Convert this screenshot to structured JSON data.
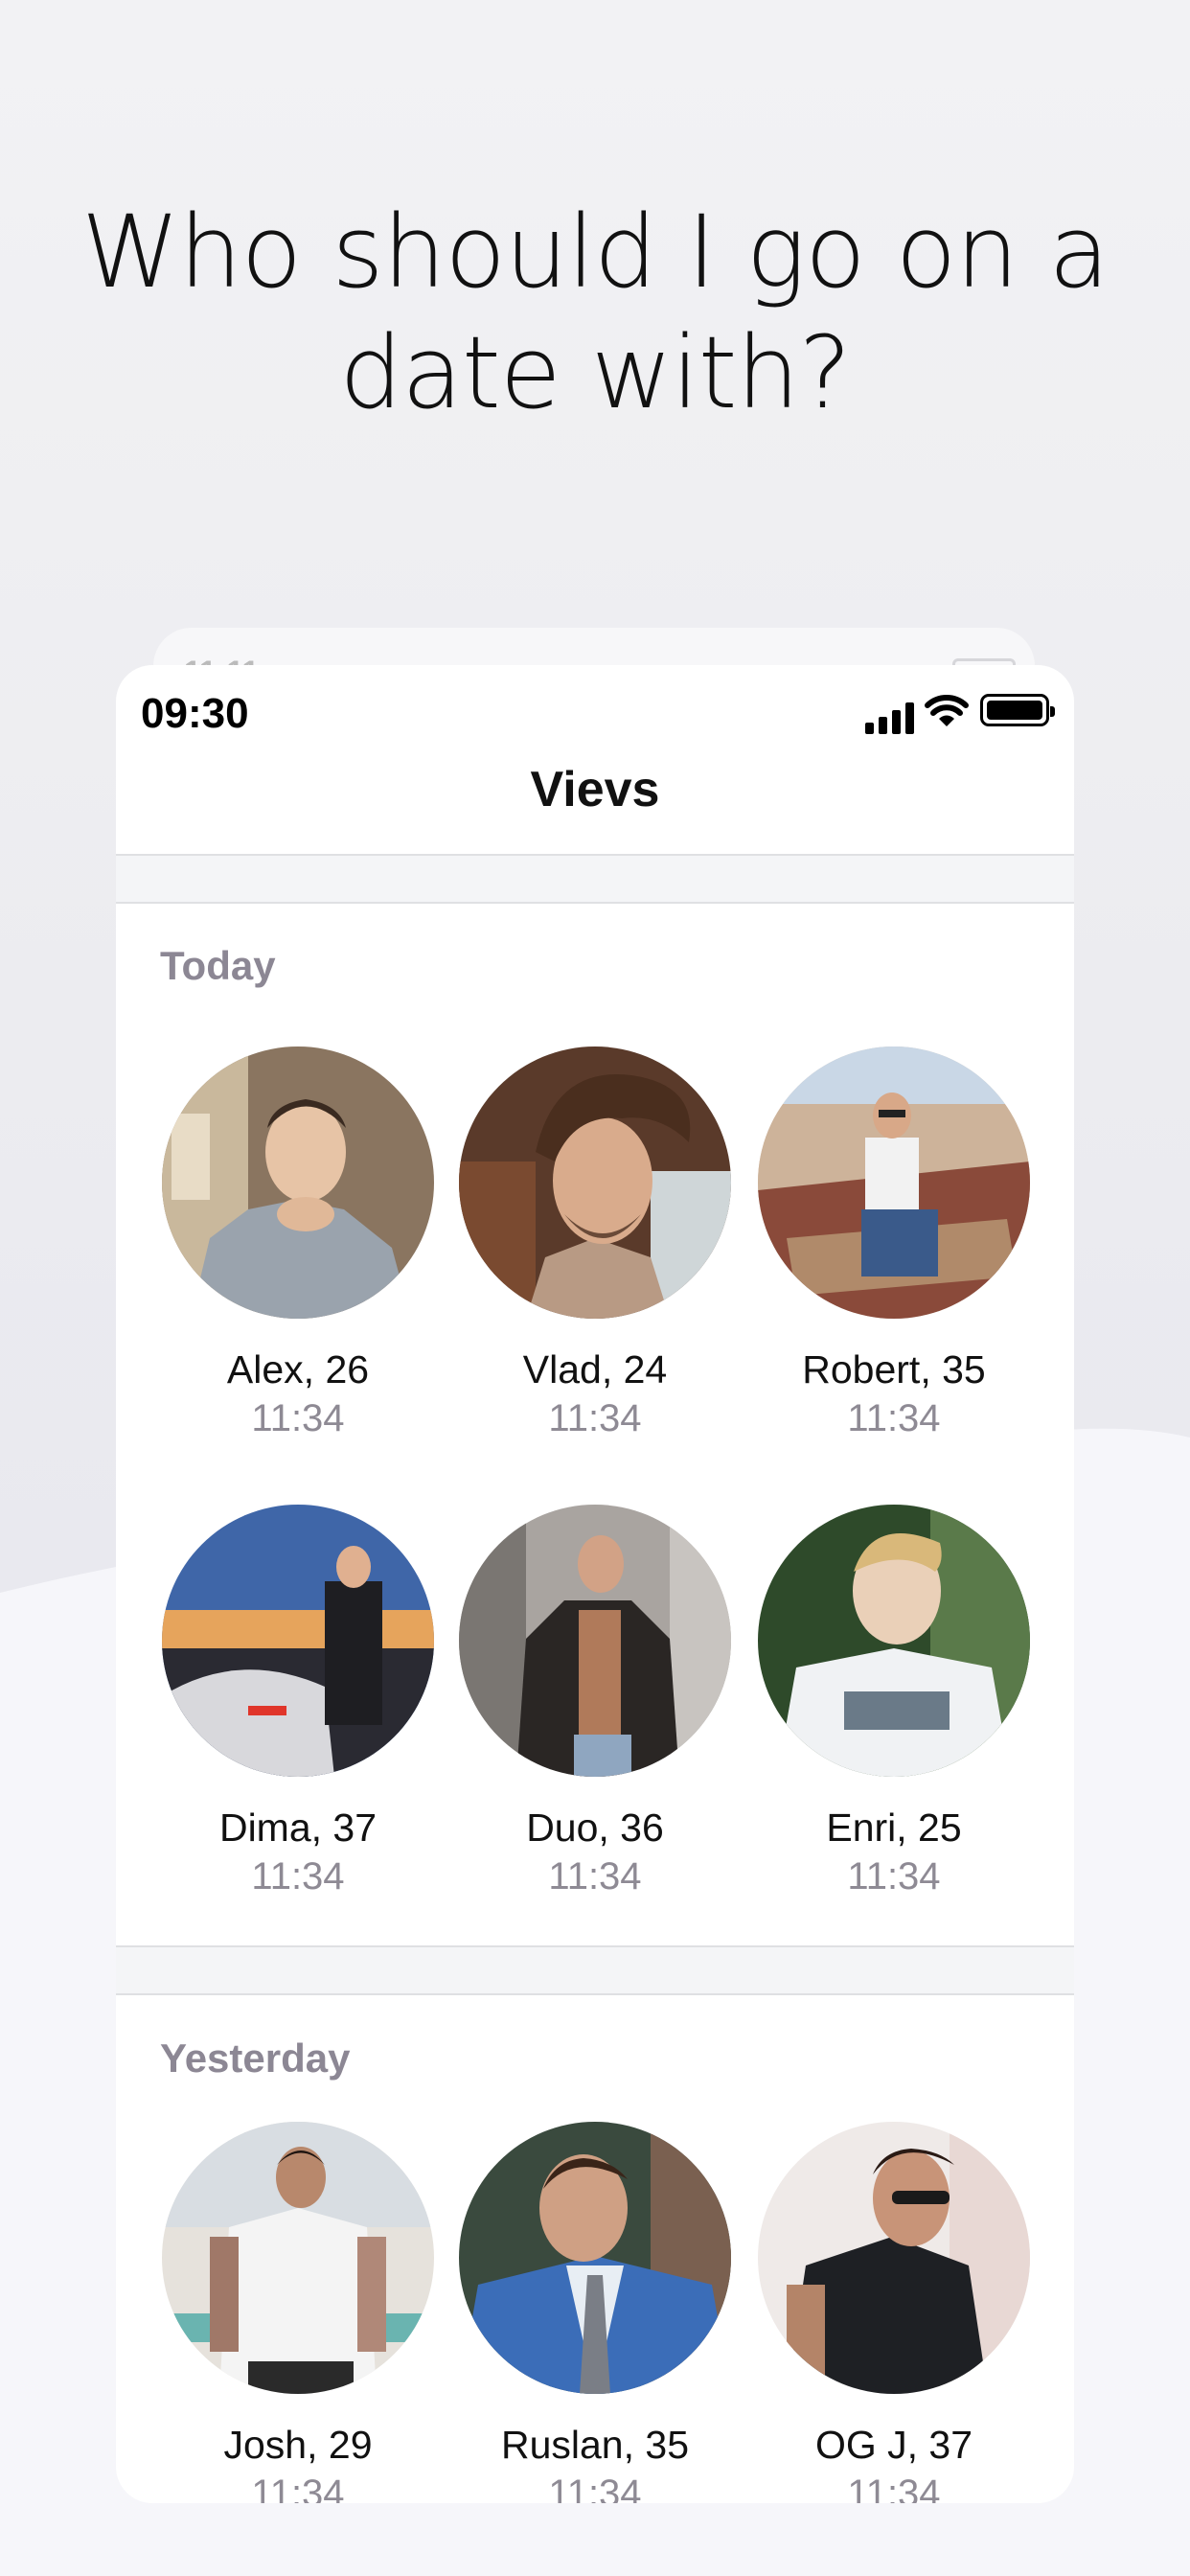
{
  "headline": {
    "line1": "Who should I go on a",
    "line2": "date with?"
  },
  "status_bar": {
    "time": "09:30"
  },
  "nav": {
    "title": "Vievs"
  },
  "sections": {
    "today": {
      "label": "Today",
      "people": [
        {
          "name": "Alex, 26",
          "time": "11:34"
        },
        {
          "name": "Vlad, 24",
          "time": "11:34"
        },
        {
          "name": "Robert, 35",
          "time": "11:34"
        },
        {
          "name": "Dima, 37",
          "time": "11:34"
        },
        {
          "name": "Duo, 36",
          "time": "11:34"
        },
        {
          "name": "Enri, 25",
          "time": "11:34"
        }
      ]
    },
    "yesterday": {
      "label": "Yesterday",
      "people": [
        {
          "name": "Josh, 29",
          "time": "11:34"
        },
        {
          "name": "Ruslan, 35",
          "time": "11:34"
        },
        {
          "name": "OG J, 37",
          "time": "11:34"
        }
      ]
    }
  }
}
